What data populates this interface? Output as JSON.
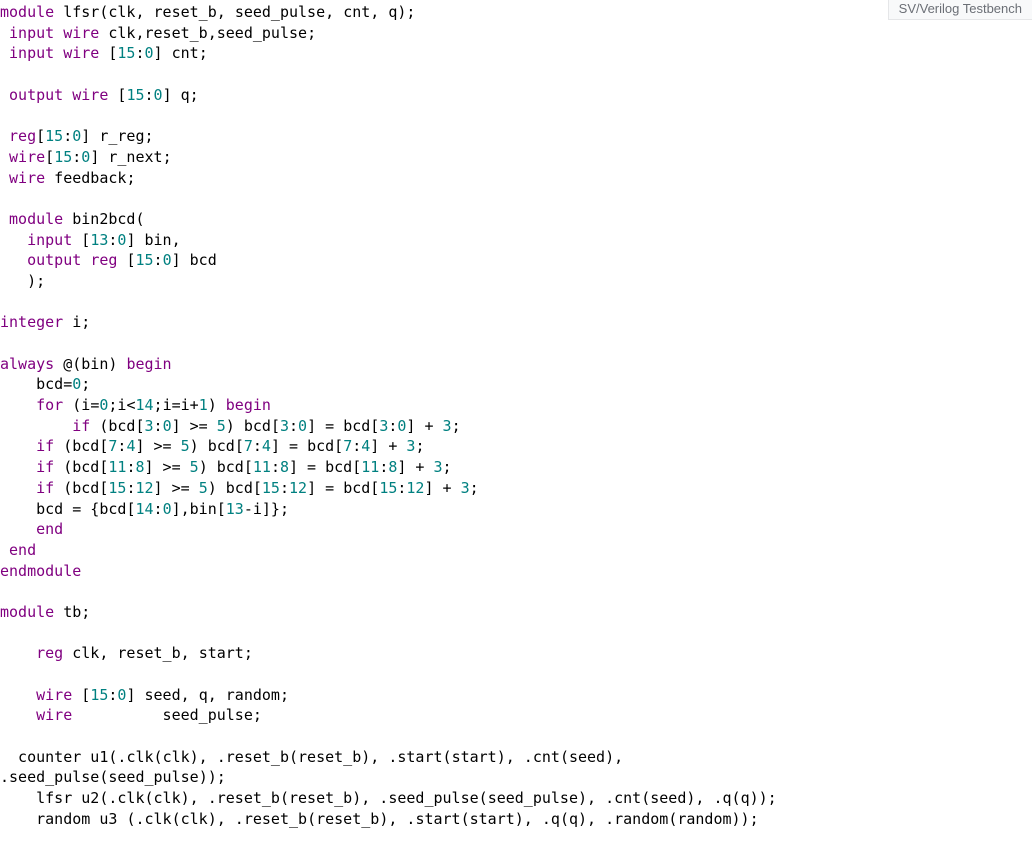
{
  "header": {
    "language_label": "SV/Verilog Testbench"
  },
  "code": {
    "lines": [
      [
        [
          "kw",
          "module"
        ],
        [
          "id",
          " lfsr"
        ],
        [
          "op",
          "("
        ],
        [
          "id",
          "clk"
        ],
        [
          "op",
          ", "
        ],
        [
          "id",
          "reset_b"
        ],
        [
          "op",
          ", "
        ],
        [
          "id",
          "seed_pulse"
        ],
        [
          "op",
          ", "
        ],
        [
          "id",
          "cnt"
        ],
        [
          "op",
          ", "
        ],
        [
          "id",
          "q"
        ],
        [
          "op",
          ");"
        ]
      ],
      [
        [
          "id",
          " "
        ],
        [
          "kw",
          "input"
        ],
        [
          "id",
          " "
        ],
        [
          "kw",
          "wire"
        ],
        [
          "id",
          " clk"
        ],
        [
          "op",
          ","
        ],
        [
          "id",
          "reset_b"
        ],
        [
          "op",
          ","
        ],
        [
          "id",
          "seed_pulse"
        ],
        [
          "op",
          ";"
        ]
      ],
      [
        [
          "id",
          " "
        ],
        [
          "kw",
          "input"
        ],
        [
          "id",
          " "
        ],
        [
          "kw",
          "wire"
        ],
        [
          "id",
          " "
        ],
        [
          "op",
          "["
        ],
        [
          "num",
          "15"
        ],
        [
          "op",
          ":"
        ],
        [
          "num",
          "0"
        ],
        [
          "op",
          "] "
        ],
        [
          "id",
          "cnt"
        ],
        [
          "op",
          ";"
        ]
      ],
      [
        [
          "id",
          " "
        ]
      ],
      [
        [
          "id",
          " "
        ],
        [
          "kw",
          "output"
        ],
        [
          "id",
          " "
        ],
        [
          "kw",
          "wire"
        ],
        [
          "id",
          " "
        ],
        [
          "op",
          "["
        ],
        [
          "num",
          "15"
        ],
        [
          "op",
          ":"
        ],
        [
          "num",
          "0"
        ],
        [
          "op",
          "] "
        ],
        [
          "id",
          "q"
        ],
        [
          "op",
          ";"
        ]
      ],
      [
        [
          "id",
          " "
        ]
      ],
      [
        [
          "id",
          " "
        ],
        [
          "kw",
          "reg"
        ],
        [
          "op",
          "["
        ],
        [
          "num",
          "15"
        ],
        [
          "op",
          ":"
        ],
        [
          "num",
          "0"
        ],
        [
          "op",
          "] "
        ],
        [
          "id",
          "r_reg"
        ],
        [
          "op",
          ";"
        ]
      ],
      [
        [
          "id",
          " "
        ],
        [
          "kw",
          "wire"
        ],
        [
          "op",
          "["
        ],
        [
          "num",
          "15"
        ],
        [
          "op",
          ":"
        ],
        [
          "num",
          "0"
        ],
        [
          "op",
          "] "
        ],
        [
          "id",
          "r_next"
        ],
        [
          "op",
          ";"
        ]
      ],
      [
        [
          "id",
          " "
        ],
        [
          "kw",
          "wire"
        ],
        [
          "id",
          " feedback"
        ],
        [
          "op",
          ";"
        ]
      ],
      [
        [
          "id",
          "  "
        ]
      ],
      [
        [
          "id",
          " "
        ],
        [
          "kw",
          "module"
        ],
        [
          "id",
          " bin2bcd"
        ],
        [
          "op",
          "("
        ]
      ],
      [
        [
          "id",
          "   "
        ],
        [
          "kw",
          "input"
        ],
        [
          "id",
          " "
        ],
        [
          "op",
          "["
        ],
        [
          "num",
          "13"
        ],
        [
          "op",
          ":"
        ],
        [
          "num",
          "0"
        ],
        [
          "op",
          "] "
        ],
        [
          "id",
          "bin"
        ],
        [
          "op",
          ","
        ]
      ],
      [
        [
          "id",
          "   "
        ],
        [
          "kw",
          "output"
        ],
        [
          "id",
          " "
        ],
        [
          "kw",
          "reg"
        ],
        [
          "id",
          " "
        ],
        [
          "op",
          "["
        ],
        [
          "num",
          "15"
        ],
        [
          "op",
          ":"
        ],
        [
          "num",
          "0"
        ],
        [
          "op",
          "] "
        ],
        [
          "id",
          "bcd"
        ]
      ],
      [
        [
          "id",
          "   "
        ],
        [
          "op",
          ");"
        ]
      ],
      [
        [
          "id",
          "   "
        ]
      ],
      [
        [
          "kw",
          "integer"
        ],
        [
          "id",
          " i"
        ],
        [
          "op",
          ";"
        ]
      ],
      [
        [
          "id",
          "   "
        ]
      ],
      [
        [
          "kw",
          "always"
        ],
        [
          "id",
          " "
        ],
        [
          "op",
          "@("
        ],
        [
          "id",
          "bin"
        ],
        [
          "op",
          ") "
        ],
        [
          "kw",
          "begin"
        ]
      ],
      [
        [
          "id",
          "    bcd"
        ],
        [
          "op",
          "="
        ],
        [
          "num",
          "0"
        ],
        [
          "op",
          ";"
        ]
      ],
      [
        [
          "id",
          "    "
        ],
        [
          "kw",
          "for"
        ],
        [
          "id",
          " "
        ],
        [
          "op",
          "("
        ],
        [
          "id",
          "i"
        ],
        [
          "op",
          "="
        ],
        [
          "num",
          "0"
        ],
        [
          "op",
          ";"
        ],
        [
          "id",
          "i"
        ],
        [
          "op",
          "<"
        ],
        [
          "num",
          "14"
        ],
        [
          "op",
          ";"
        ],
        [
          "id",
          "i"
        ],
        [
          "op",
          "="
        ],
        [
          "id",
          "i"
        ],
        [
          "op",
          "+"
        ],
        [
          "num",
          "1"
        ],
        [
          "op",
          ") "
        ],
        [
          "kw",
          "begin"
        ]
      ],
      [
        [
          "id",
          "        "
        ],
        [
          "kw",
          "if"
        ],
        [
          "id",
          " "
        ],
        [
          "op",
          "("
        ],
        [
          "id",
          "bcd"
        ],
        [
          "op",
          "["
        ],
        [
          "num",
          "3"
        ],
        [
          "op",
          ":"
        ],
        [
          "num",
          "0"
        ],
        [
          "op",
          "] >= "
        ],
        [
          "num",
          "5"
        ],
        [
          "op",
          ") "
        ],
        [
          "id",
          "bcd"
        ],
        [
          "op",
          "["
        ],
        [
          "num",
          "3"
        ],
        [
          "op",
          ":"
        ],
        [
          "num",
          "0"
        ],
        [
          "op",
          "] = "
        ],
        [
          "id",
          "bcd"
        ],
        [
          "op",
          "["
        ],
        [
          "num",
          "3"
        ],
        [
          "op",
          ":"
        ],
        [
          "num",
          "0"
        ],
        [
          "op",
          "] + "
        ],
        [
          "num",
          "3"
        ],
        [
          "op",
          ";"
        ]
      ],
      [
        [
          "id",
          "    "
        ],
        [
          "kw",
          "if"
        ],
        [
          "id",
          " "
        ],
        [
          "op",
          "("
        ],
        [
          "id",
          "bcd"
        ],
        [
          "op",
          "["
        ],
        [
          "num",
          "7"
        ],
        [
          "op",
          ":"
        ],
        [
          "num",
          "4"
        ],
        [
          "op",
          "] >= "
        ],
        [
          "num",
          "5"
        ],
        [
          "op",
          ") "
        ],
        [
          "id",
          "bcd"
        ],
        [
          "op",
          "["
        ],
        [
          "num",
          "7"
        ],
        [
          "op",
          ":"
        ],
        [
          "num",
          "4"
        ],
        [
          "op",
          "] = "
        ],
        [
          "id",
          "bcd"
        ],
        [
          "op",
          "["
        ],
        [
          "num",
          "7"
        ],
        [
          "op",
          ":"
        ],
        [
          "num",
          "4"
        ],
        [
          "op",
          "] + "
        ],
        [
          "num",
          "3"
        ],
        [
          "op",
          ";"
        ]
      ],
      [
        [
          "id",
          "    "
        ],
        [
          "kw",
          "if"
        ],
        [
          "id",
          " "
        ],
        [
          "op",
          "("
        ],
        [
          "id",
          "bcd"
        ],
        [
          "op",
          "["
        ],
        [
          "num",
          "11"
        ],
        [
          "op",
          ":"
        ],
        [
          "num",
          "8"
        ],
        [
          "op",
          "] >= "
        ],
        [
          "num",
          "5"
        ],
        [
          "op",
          ") "
        ],
        [
          "id",
          "bcd"
        ],
        [
          "op",
          "["
        ],
        [
          "num",
          "11"
        ],
        [
          "op",
          ":"
        ],
        [
          "num",
          "8"
        ],
        [
          "op",
          "] = "
        ],
        [
          "id",
          "bcd"
        ],
        [
          "op",
          "["
        ],
        [
          "num",
          "11"
        ],
        [
          "op",
          ":"
        ],
        [
          "num",
          "8"
        ],
        [
          "op",
          "] + "
        ],
        [
          "num",
          "3"
        ],
        [
          "op",
          ";"
        ]
      ],
      [
        [
          "id",
          "    "
        ],
        [
          "kw",
          "if"
        ],
        [
          "id",
          " "
        ],
        [
          "op",
          "("
        ],
        [
          "id",
          "bcd"
        ],
        [
          "op",
          "["
        ],
        [
          "num",
          "15"
        ],
        [
          "op",
          ":"
        ],
        [
          "num",
          "12"
        ],
        [
          "op",
          "] >= "
        ],
        [
          "num",
          "5"
        ],
        [
          "op",
          ") "
        ],
        [
          "id",
          "bcd"
        ],
        [
          "op",
          "["
        ],
        [
          "num",
          "15"
        ],
        [
          "op",
          ":"
        ],
        [
          "num",
          "12"
        ],
        [
          "op",
          "] = "
        ],
        [
          "id",
          "bcd"
        ],
        [
          "op",
          "["
        ],
        [
          "num",
          "15"
        ],
        [
          "op",
          ":"
        ],
        [
          "num",
          "12"
        ],
        [
          "op",
          "] + "
        ],
        [
          "num",
          "3"
        ],
        [
          "op",
          ";"
        ]
      ],
      [
        [
          "id",
          "    bcd "
        ],
        [
          "op",
          "= {"
        ],
        [
          "id",
          "bcd"
        ],
        [
          "op",
          "["
        ],
        [
          "num",
          "14"
        ],
        [
          "op",
          ":"
        ],
        [
          "num",
          "0"
        ],
        [
          "op",
          "],"
        ],
        [
          "id",
          "bin"
        ],
        [
          "op",
          "["
        ],
        [
          "num",
          "13"
        ],
        [
          "op",
          "-"
        ],
        [
          "id",
          "i"
        ],
        [
          "op",
          "]};"
        ]
      ],
      [
        [
          "id",
          "    "
        ],
        [
          "kw",
          "end"
        ]
      ],
      [
        [
          "id",
          " "
        ],
        [
          "kw",
          "end"
        ]
      ],
      [
        [
          "kw",
          "endmodule"
        ]
      ],
      [
        [
          "id",
          " "
        ]
      ],
      [
        [
          "kw",
          "module"
        ],
        [
          "id",
          " tb"
        ],
        [
          "op",
          ";"
        ]
      ],
      [
        [
          "id",
          "   "
        ]
      ],
      [
        [
          "id",
          "    "
        ],
        [
          "kw",
          "reg"
        ],
        [
          "id",
          " clk"
        ],
        [
          "op",
          ", "
        ],
        [
          "id",
          "reset_b"
        ],
        [
          "op",
          ", "
        ],
        [
          "id",
          "start"
        ],
        [
          "op",
          ";"
        ]
      ],
      [
        [
          "id",
          "  "
        ]
      ],
      [
        [
          "id",
          "    "
        ],
        [
          "kw",
          "wire"
        ],
        [
          "id",
          " "
        ],
        [
          "op",
          "["
        ],
        [
          "num",
          "15"
        ],
        [
          "op",
          ":"
        ],
        [
          "num",
          "0"
        ],
        [
          "op",
          "] "
        ],
        [
          "id",
          "seed"
        ],
        [
          "op",
          ", "
        ],
        [
          "id",
          "q"
        ],
        [
          "op",
          ", "
        ],
        [
          "id",
          "random"
        ],
        [
          "op",
          ";"
        ]
      ],
      [
        [
          "id",
          "    "
        ],
        [
          "kw",
          "wire"
        ],
        [
          "id",
          "          seed_pulse"
        ],
        [
          "op",
          ";"
        ]
      ],
      [
        [
          "id",
          "  "
        ]
      ],
      [
        [
          "id",
          "  counter u1"
        ],
        [
          "op",
          "(."
        ],
        [
          "id",
          "clk"
        ],
        [
          "op",
          "("
        ],
        [
          "id",
          "clk"
        ],
        [
          "op",
          "), ."
        ],
        [
          "id",
          "reset_b"
        ],
        [
          "op",
          "("
        ],
        [
          "id",
          "reset_b"
        ],
        [
          "op",
          "), ."
        ],
        [
          "id",
          "start"
        ],
        [
          "op",
          "("
        ],
        [
          "id",
          "start"
        ],
        [
          "op",
          "), ."
        ],
        [
          "id",
          "cnt"
        ],
        [
          "op",
          "("
        ],
        [
          "id",
          "seed"
        ],
        [
          "op",
          "), "
        ]
      ],
      [
        [
          "op",
          "."
        ],
        [
          "id",
          "seed_pulse"
        ],
        [
          "op",
          "("
        ],
        [
          "id",
          "seed_pulse"
        ],
        [
          "op",
          "));"
        ]
      ],
      [
        [
          "id",
          "    lfsr u2"
        ],
        [
          "op",
          "(."
        ],
        [
          "id",
          "clk"
        ],
        [
          "op",
          "("
        ],
        [
          "id",
          "clk"
        ],
        [
          "op",
          "), ."
        ],
        [
          "id",
          "reset_b"
        ],
        [
          "op",
          "("
        ],
        [
          "id",
          "reset_b"
        ],
        [
          "op",
          "), ."
        ],
        [
          "id",
          "seed_pulse"
        ],
        [
          "op",
          "("
        ],
        [
          "id",
          "seed_pulse"
        ],
        [
          "op",
          "), ."
        ],
        [
          "id",
          "cnt"
        ],
        [
          "op",
          "("
        ],
        [
          "id",
          "seed"
        ],
        [
          "op",
          "), ."
        ],
        [
          "id",
          "q"
        ],
        [
          "op",
          "("
        ],
        [
          "id",
          "q"
        ],
        [
          "op",
          "));"
        ]
      ],
      [
        [
          "id",
          "    random u3 "
        ],
        [
          "op",
          "(."
        ],
        [
          "id",
          "clk"
        ],
        [
          "op",
          "("
        ],
        [
          "id",
          "clk"
        ],
        [
          "op",
          "), ."
        ],
        [
          "id",
          "reset_b"
        ],
        [
          "op",
          "("
        ],
        [
          "id",
          "reset_b"
        ],
        [
          "op",
          "), ."
        ],
        [
          "id",
          "start"
        ],
        [
          "op",
          "("
        ],
        [
          "id",
          "start"
        ],
        [
          "op",
          "), ."
        ],
        [
          "id",
          "q"
        ],
        [
          "op",
          "("
        ],
        [
          "id",
          "q"
        ],
        [
          "op",
          "), ."
        ],
        [
          "id",
          "random"
        ],
        [
          "op",
          "("
        ],
        [
          "id",
          "random"
        ],
        [
          "op",
          "));"
        ]
      ]
    ]
  }
}
